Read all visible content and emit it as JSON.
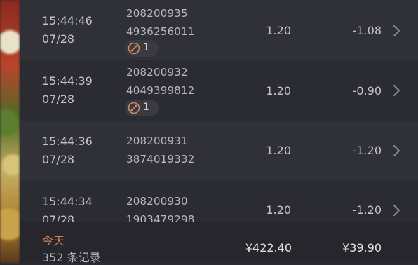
{
  "transactions": [
    {
      "time": "15:44:46",
      "date": "07/28",
      "id_line1": "208200935",
      "id_line2": "4936256011",
      "badge_count": "1",
      "amount": "1.20",
      "change": "-1.08",
      "has_badge": true
    },
    {
      "time": "15:44:39",
      "date": "07/28",
      "id_line1": "208200932",
      "id_line2": "4049399812",
      "badge_count": "1",
      "amount": "1.20",
      "change": "-0.90",
      "has_badge": true
    },
    {
      "time": "15:44:36",
      "date": "07/28",
      "id_line1": "208200931",
      "id_line2": "3874019332",
      "amount": "1.20",
      "change": "-1.20",
      "has_badge": false
    },
    {
      "time": "15:44:34",
      "date": "07/28",
      "id_line1": "208200930",
      "id_line2": "1903479298",
      "amount": "1.20",
      "change": "-1.20",
      "has_badge": false
    }
  ],
  "footer": {
    "label": "今天",
    "records": "352 条记录",
    "total_amount": "¥422.40",
    "total_change": "¥39.90"
  },
  "colors": {
    "background": "#2b2b32",
    "row_alt": "#303038",
    "footer_bg": "#26262c",
    "accent": "#c9825a"
  },
  "icons": {
    "badge": "link-badge-icon",
    "row_action": "chevron-right-icon"
  }
}
